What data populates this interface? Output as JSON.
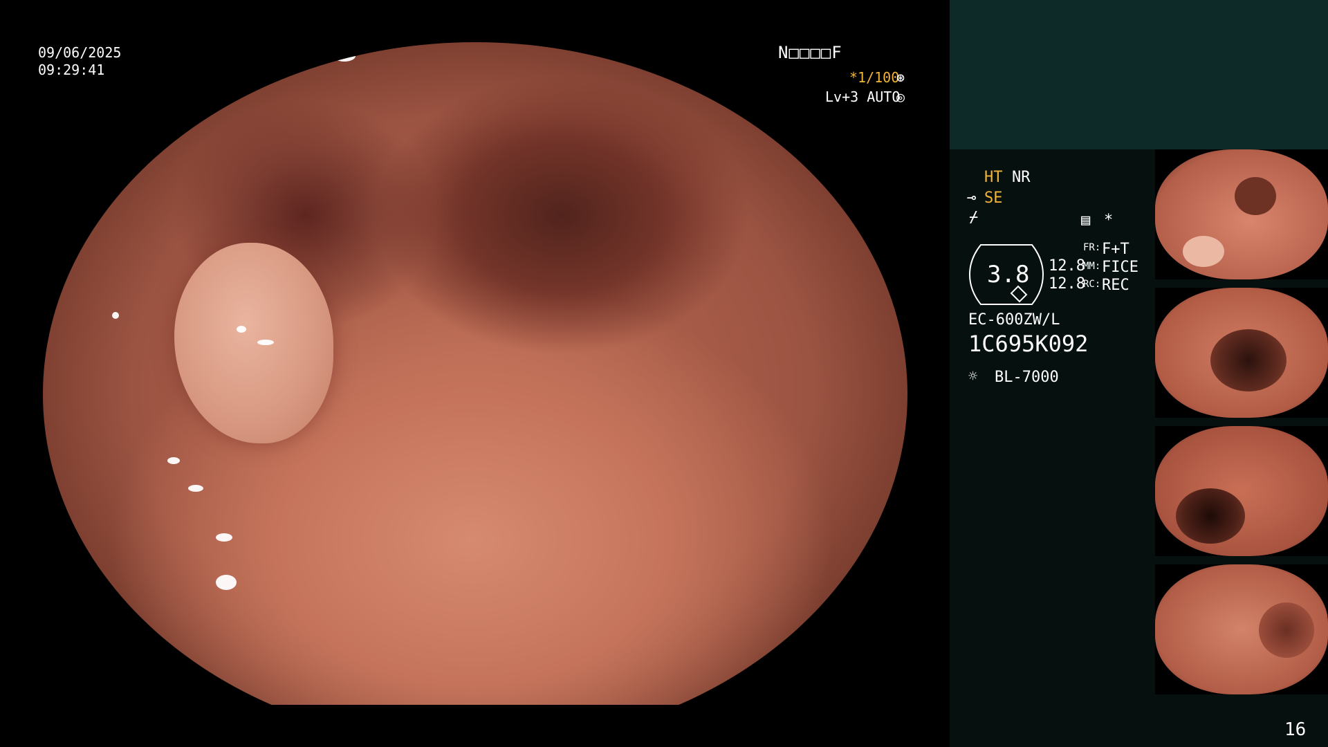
{
  "osd": {
    "date": "09/06/2025",
    "time": "09:29:41",
    "mode_code": "N□□□□F",
    "shutter": "*1/100",
    "level": "Lv+3 AUTO"
  },
  "panel": {
    "ht": "HT",
    "nr": "NR",
    "se": "SE",
    "lightning_icon": "⌿",
    "star": "*",
    "mag_value": "3.8",
    "row1_num": "12.8",
    "row2_num": "12.8",
    "fr_label": "FR:",
    "fr_value": "F+T",
    "mm_label": "MM:",
    "mm_value": "FICE",
    "rc_label": "RC:",
    "rc_value": "REC",
    "scope_model": "EC-600ZW/L",
    "serial": "1C695K092",
    "light_source": "BL-7000",
    "page_number": "16"
  },
  "colors": {
    "accent_yellow": "#f2b437",
    "panel_bg": "#06110f",
    "panel_top_bg": "#0e2a28"
  },
  "icons": [
    "scope-icon",
    "lightning-icon",
    "settings-icon",
    "star-icon",
    "light-source-icon",
    "shutter-icon",
    "auto-icon"
  ]
}
